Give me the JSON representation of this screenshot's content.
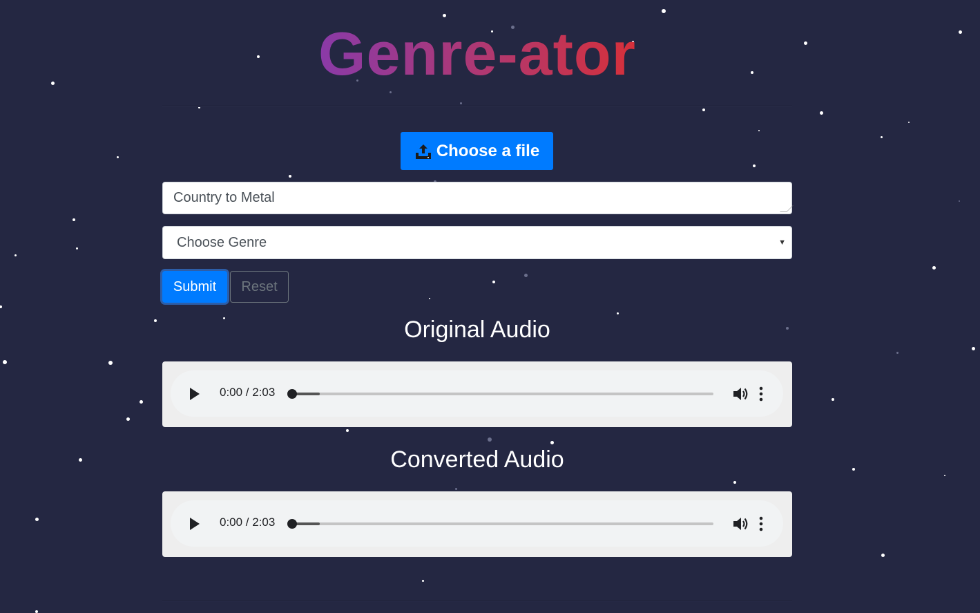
{
  "app": {
    "title": "Genre-ator",
    "title_gradient": [
      "#8a3aa8",
      "#b2386e",
      "#d6303a"
    ],
    "background": "#242742"
  },
  "upload": {
    "label": "Choose a file",
    "icon": "upload-icon",
    "color": "#007bff"
  },
  "prompt": {
    "value": "Country to Metal"
  },
  "genre_select": {
    "selected": "Choose Genre"
  },
  "actions": {
    "submit_label": "Submit",
    "reset_label": "Reset"
  },
  "original_audio": {
    "heading": "Original Audio",
    "time": "0:00 / 2:03",
    "progress": 0,
    "buffered": 0.066
  },
  "converted_audio": {
    "heading": "Converted Audio",
    "time": "0:00 / 2:03",
    "progress": 0,
    "buffered": 0.066
  },
  "icons": {
    "play": "play-icon",
    "volume": "volume-icon",
    "more": "more-vert-icon"
  }
}
